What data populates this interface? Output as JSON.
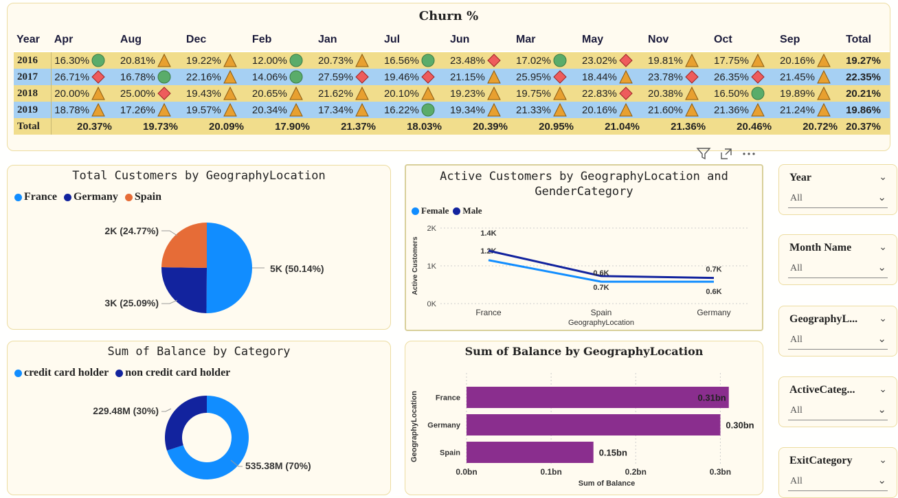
{
  "churn": {
    "title": "Churn %",
    "columns": [
      "Year",
      "Apr",
      "Aug",
      "Dec",
      "Feb",
      "Jan",
      "Jul",
      "Jun",
      "Mar",
      "May",
      "Nov",
      "Oct",
      "Sep",
      "Total"
    ],
    "rows": [
      {
        "year": "2016",
        "cells": [
          [
            "16.30%",
            "circle"
          ],
          [
            "20.81%",
            "triangle"
          ],
          [
            "19.22%",
            "triangle"
          ],
          [
            "12.00%",
            "circle"
          ],
          [
            "20.73%",
            "triangle"
          ],
          [
            "16.56%",
            "circle"
          ],
          [
            "23.48%",
            "diamond"
          ],
          [
            "17.02%",
            "circle"
          ],
          [
            "23.02%",
            "diamond"
          ],
          [
            "19.81%",
            "triangle"
          ],
          [
            "17.75%",
            "triangle"
          ],
          [
            "20.16%",
            "triangle"
          ]
        ],
        "total": "19.27%"
      },
      {
        "year": "2017",
        "cells": [
          [
            "26.71%",
            "diamond"
          ],
          [
            "16.78%",
            "circle"
          ],
          [
            "22.16%",
            "triangle"
          ],
          [
            "14.06%",
            "circle"
          ],
          [
            "27.59%",
            "diamond"
          ],
          [
            "19.46%",
            "diamond"
          ],
          [
            "21.15%",
            "triangle"
          ],
          [
            "25.95%",
            "diamond"
          ],
          [
            "18.44%",
            "triangle"
          ],
          [
            "23.78%",
            "diamond"
          ],
          [
            "26.35%",
            "diamond"
          ],
          [
            "21.45%",
            "triangle"
          ]
        ],
        "total": "22.35%"
      },
      {
        "year": "2018",
        "cells": [
          [
            "20.00%",
            "triangle"
          ],
          [
            "25.00%",
            "diamond"
          ],
          [
            "19.43%",
            "triangle"
          ],
          [
            "20.65%",
            "triangle"
          ],
          [
            "21.62%",
            "triangle"
          ],
          [
            "20.10%",
            "triangle"
          ],
          [
            "19.23%",
            "triangle"
          ],
          [
            "19.75%",
            "triangle"
          ],
          [
            "22.83%",
            "diamond"
          ],
          [
            "20.38%",
            "triangle"
          ],
          [
            "16.50%",
            "circle"
          ],
          [
            "19.89%",
            "triangle"
          ]
        ],
        "total": "20.21%"
      },
      {
        "year": "2019",
        "cells": [
          [
            "18.78%",
            "triangle"
          ],
          [
            "17.26%",
            "triangle"
          ],
          [
            "19.57%",
            "triangle"
          ],
          [
            "20.34%",
            "triangle"
          ],
          [
            "17.34%",
            "triangle"
          ],
          [
            "16.22%",
            "circle"
          ],
          [
            "19.34%",
            "triangle"
          ],
          [
            "21.33%",
            "triangle"
          ],
          [
            "20.16%",
            "triangle"
          ],
          [
            "21.60%",
            "triangle"
          ],
          [
            "21.36%",
            "triangle"
          ],
          [
            "21.24%",
            "triangle"
          ]
        ],
        "total": "19.86%"
      }
    ],
    "total_row": {
      "label": "Total",
      "values": [
        "20.37%",
        "19.73%",
        "20.09%",
        "17.90%",
        "21.37%",
        "18.03%",
        "20.39%",
        "20.95%",
        "21.04%",
        "21.36%",
        "20.46%",
        "20.72%",
        "20.37%"
      ]
    }
  },
  "colors": {
    "kpi_good": "#5aac6a",
    "kpi_mid": "#e8a030",
    "kpi_bad": "#ee5c5c",
    "france": "#118dff",
    "germany": "#12239e",
    "spain": "#e66c37",
    "bar": "#8a2e8e"
  },
  "toolbar": {
    "icons": [
      "filter-icon",
      "focus-mode-icon",
      "more-options-icon"
    ]
  },
  "slicers": [
    {
      "label": "Year",
      "value": "All"
    },
    {
      "label": "Month Name",
      "value": "All"
    },
    {
      "label": "GeographyL...",
      "value": "All"
    },
    {
      "label": "ActiveCateg...",
      "value": "All"
    },
    {
      "label": "ExitCategory",
      "value": "All"
    }
  ],
  "chart_data": [
    {
      "type": "pie",
      "title": "Total Customers by GeographyLocation",
      "legend": [
        "France",
        "Germany",
        "Spain"
      ],
      "slices": [
        {
          "name": "France",
          "value": 5014,
          "label": "5K (50.14%)"
        },
        {
          "name": "Germany",
          "value": 2509,
          "label": "3K (25.09%)"
        },
        {
          "name": "Spain",
          "value": 2477,
          "label": "2K (24.77%)"
        }
      ]
    },
    {
      "type": "line",
      "title": "Active Customers by GeographyLocation and GenderCategory",
      "xlabel": "GeographyLocation",
      "ylabel": "Active Customers",
      "categories": [
        "France",
        "Spain",
        "Germany"
      ],
      "yticks": [
        "0K",
        "1K",
        "2K"
      ],
      "ylim": [
        0,
        2000
      ],
      "series": [
        {
          "name": "Female",
          "values": [
            1150,
            580,
            580
          ],
          "labels": [
            "1.2K",
            "0.7K",
            "0.6K"
          ]
        },
        {
          "name": "Male",
          "values": [
            1400,
            730,
            680
          ],
          "labels": [
            "1.4K",
            "0.6K",
            "0.7K"
          ]
        }
      ]
    },
    {
      "type": "donut",
      "title": "Sum of Balance by Category",
      "legend": [
        "credit card holder",
        "non credit card holder"
      ],
      "slices": [
        {
          "name": "credit card holder",
          "value": 535.38,
          "label": "535.38M (70%)"
        },
        {
          "name": "non credit card holder",
          "value": 229.48,
          "label": "229.48M (30%)"
        }
      ]
    },
    {
      "type": "bar",
      "orientation": "horizontal",
      "title": "Sum of Balance by GeographyLocation",
      "xlabel": "Sum of Balance",
      "ylabel": "GeographyLocation",
      "categories": [
        "France",
        "Germany",
        "Spain"
      ],
      "values": [
        0.31,
        0.3,
        0.15
      ],
      "labels": [
        "0.31bn",
        "0.30bn",
        "0.15bn"
      ],
      "xticks": [
        "0.0bn",
        "0.1bn",
        "0.2bn",
        "0.3bn"
      ],
      "xlim": [
        0,
        0.35
      ]
    }
  ]
}
